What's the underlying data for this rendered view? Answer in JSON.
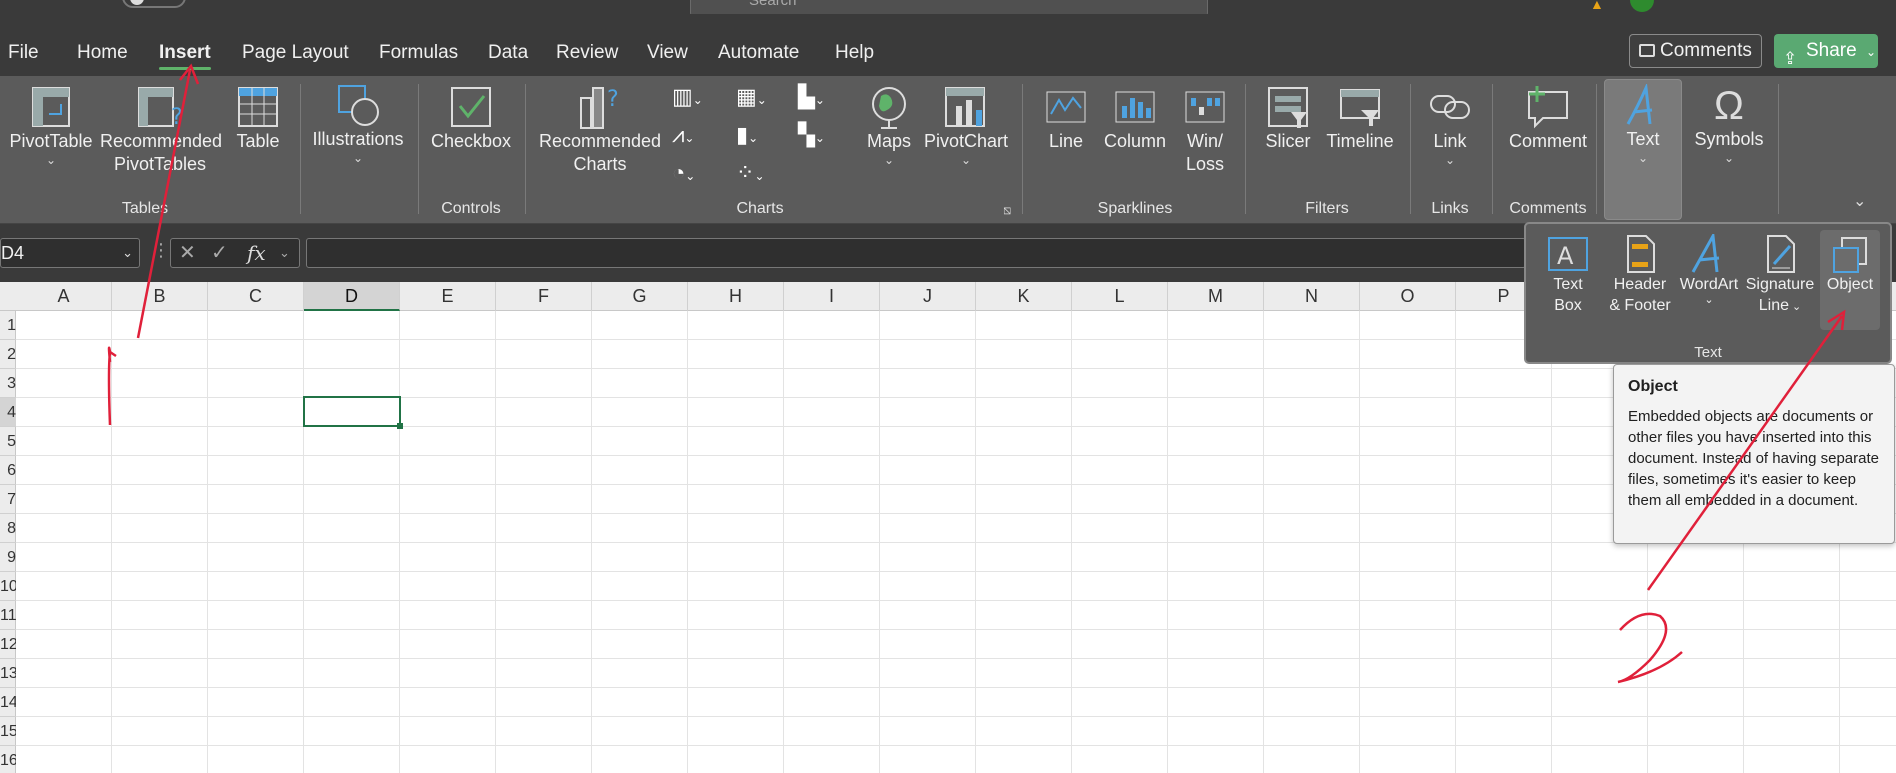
{
  "titlebar": {
    "search_placeholder": "Search"
  },
  "tabs": [
    "File",
    "Home",
    "Insert",
    "Page Layout",
    "Formulas",
    "Data",
    "Review",
    "View",
    "Automate",
    "Help"
  ],
  "actions": {
    "comments": "Comments",
    "share": "Share"
  },
  "ribbon": {
    "tables": {
      "pivottable": "PivotTable",
      "recommended1": "Recommended",
      "recommended2": "PivotTables",
      "table": "Table",
      "label": "Tables"
    },
    "illustrations": "Illustrations",
    "controls": {
      "checkbox": "Checkbox",
      "label": "Controls"
    },
    "charts": {
      "rec1": "Recommended",
      "rec2": "Charts",
      "maps": "Maps",
      "pivotchart": "PivotChart",
      "label": "Charts"
    },
    "sparklines": {
      "line": "Line",
      "column": "Column",
      "winloss1": "Win/",
      "winloss2": "Loss",
      "label": "Sparklines"
    },
    "filters": {
      "slicer": "Slicer",
      "timeline": "Timeline",
      "label": "Filters"
    },
    "links": {
      "link": "Link",
      "label": "Links"
    },
    "comments": {
      "comment": "Comment",
      "label": "Comments"
    },
    "text": "Text",
    "symbols": "Symbols"
  },
  "formula_bar": {
    "name_box": "D4",
    "fx": "fx"
  },
  "columns": [
    "A",
    "B",
    "C",
    "D",
    "E",
    "F",
    "G",
    "H",
    "I",
    "J",
    "K",
    "L",
    "M",
    "N",
    "O",
    "P"
  ],
  "rows": [
    "1",
    "2",
    "3",
    "4",
    "5",
    "6",
    "7",
    "8",
    "9",
    "10",
    "11",
    "12",
    "13",
    "14",
    "15",
    "16"
  ],
  "text_panel": {
    "textbox1": "Text",
    "textbox2": "Box",
    "header1": "Header",
    "header2": "& Footer",
    "wordart": "WordArt",
    "sig1": "Signature",
    "sig2": "Line",
    "object": "Object",
    "label": "Text"
  },
  "tooltip": {
    "title": "Object",
    "body": "Embedded objects are documents or other files you have inserted into this document. Instead of having separate files, sometimes it's easier to keep them all embedded in a document."
  },
  "annotations": {
    "mark1": "1",
    "mark2": "2"
  },
  "colors": {
    "accent_green": "#217346",
    "share_green": "#5aa972",
    "annotation_red": "#e0203a"
  }
}
